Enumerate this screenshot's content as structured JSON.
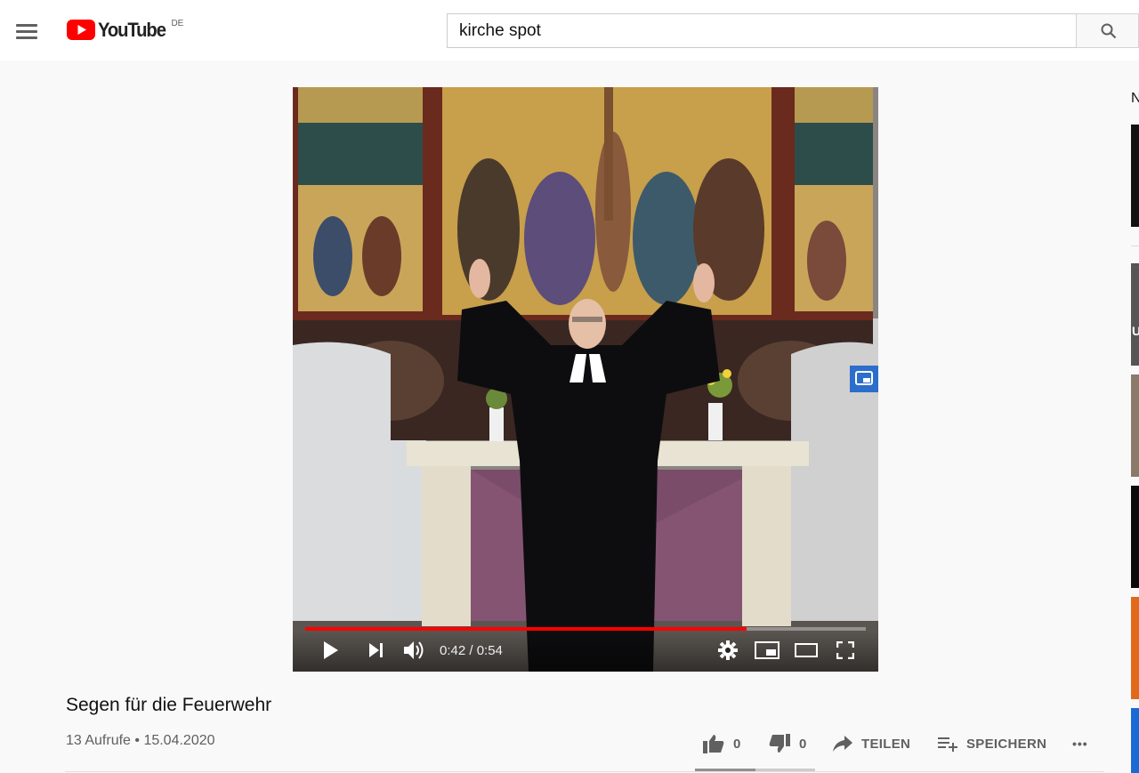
{
  "masthead": {
    "menu_icon": "hamburger-menu-icon",
    "logo_text": "YouTube",
    "logo_country": "DE",
    "search_value": "kirche spot",
    "search_icon": "search-icon"
  },
  "player": {
    "time_current": "0:42",
    "time_total": "0:54",
    "time_label": "0:42 / 0:54",
    "progress_fraction": 0.787,
    "icons": [
      "play-icon",
      "next-icon",
      "volume-icon",
      "settings-icon",
      "miniplayer-icon",
      "theater-icon",
      "fullscreen-icon"
    ]
  },
  "video": {
    "title": "Segen für die Feuerwehr",
    "meta": "13 Aufrufe • 15.04.2020",
    "like_count": "0",
    "dislike_count": "0",
    "share_label": "TEILEN",
    "save_label": "SPEICHERN",
    "more_label": "•••",
    "like_fraction": 0.5
  },
  "sidebar": {
    "heading_fragment": "N",
    "thumb_overlay_fragment": "U"
  },
  "colors": {
    "brand_red": "#ff0000",
    "progress_red": "#ff0000",
    "cast_blue": "#2c6ecb",
    "text_secondary": "#606060"
  }
}
